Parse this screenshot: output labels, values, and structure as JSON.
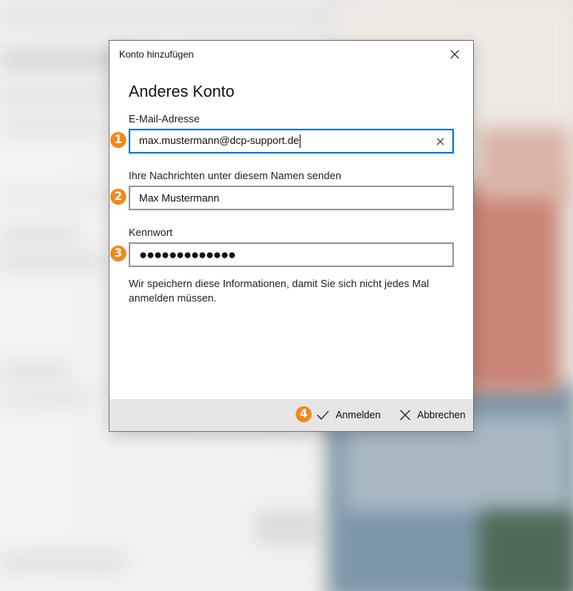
{
  "dialog": {
    "title": "Konto hinzufügen",
    "heading": "Anderes Konto"
  },
  "email": {
    "label": "E-Mail-Adresse",
    "value": "max.mustermann@dcp-support.de"
  },
  "name": {
    "label": "Ihre Nachrichten unter diesem Namen senden",
    "value": "Max Mustermann"
  },
  "password": {
    "label": "Kennwort",
    "masked_value": "●●●●●●●●●●●●●"
  },
  "note": "Wir speichern diese Informationen, damit Sie sich nicht jedes Mal anmelden müssen.",
  "footer": {
    "signin_label": "Anmelden",
    "cancel_label": "Abbrechen"
  },
  "badges": [
    "1",
    "2",
    "3",
    "4"
  ],
  "icons": {
    "close": "close-icon",
    "clear": "clear-icon",
    "check": "checkmark-icon",
    "cancel": "cancel-x-icon"
  },
  "colors": {
    "badge": "#f18a1b",
    "focus_border": "#0078d7",
    "footer_bg": "#e6e6e6"
  }
}
